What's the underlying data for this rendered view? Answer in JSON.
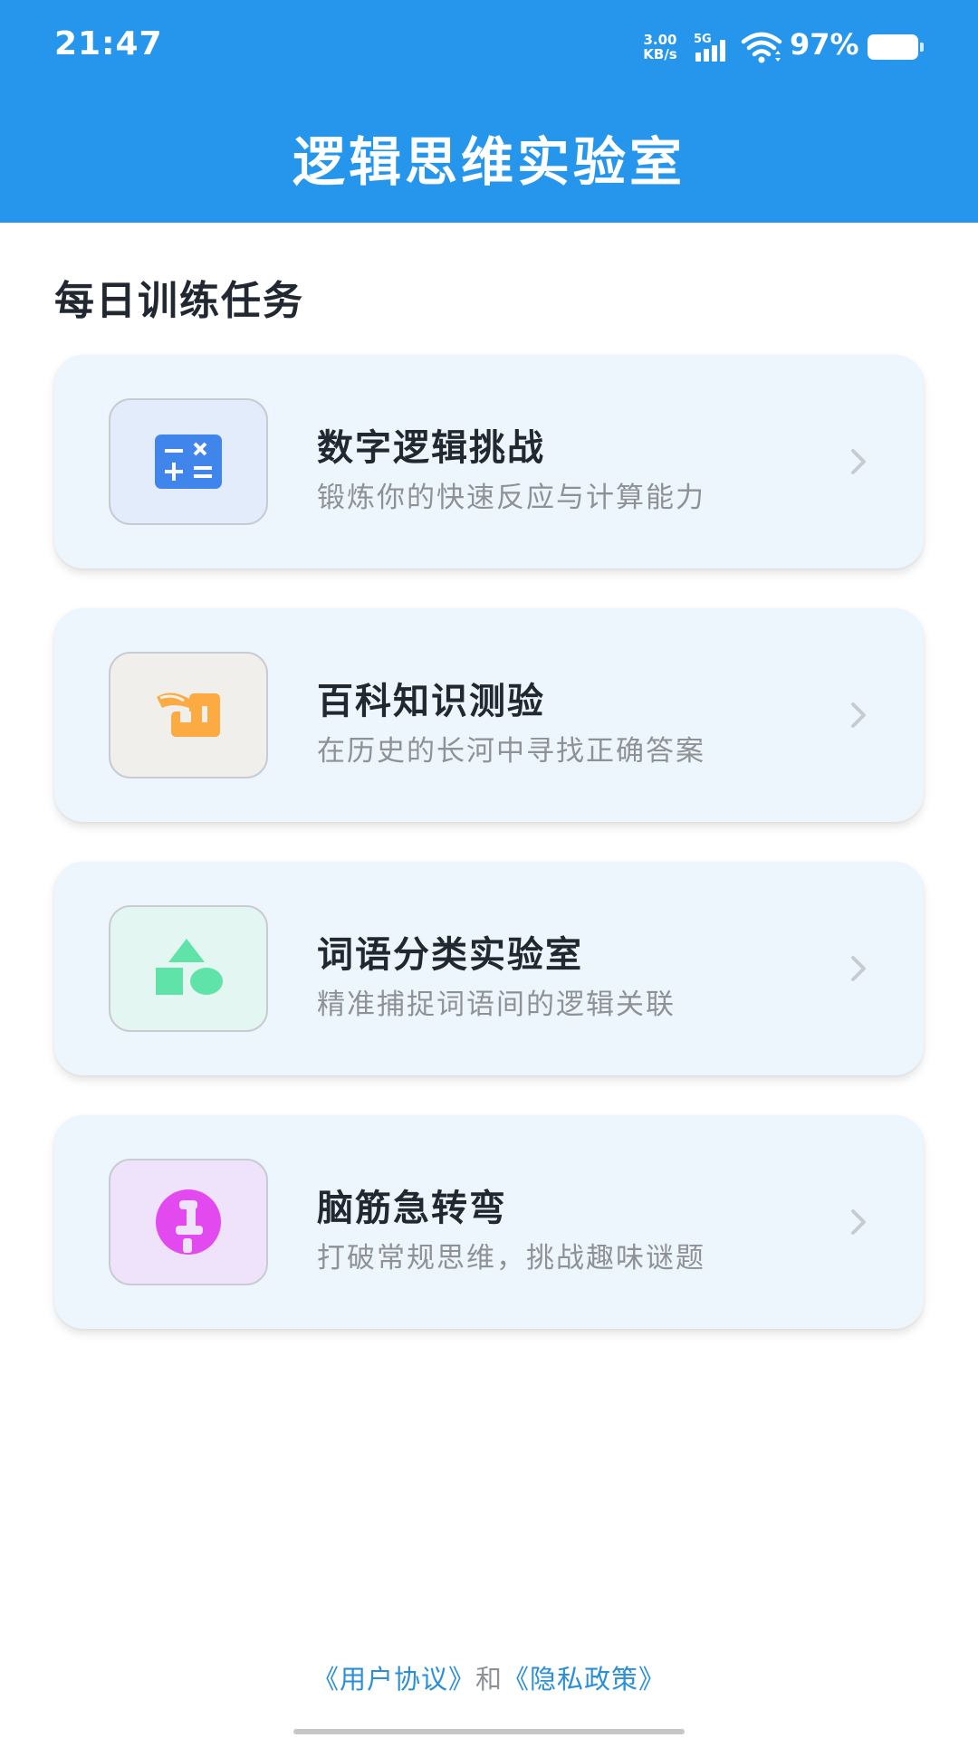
{
  "status_bar": {
    "time": "21:47",
    "net_speed_value": "3.00",
    "net_speed_unit": "KB/s",
    "network_type": "5G",
    "battery_percent": "97%"
  },
  "header": {
    "title": "逻辑思维实验室"
  },
  "section": {
    "title": "每日训练任务"
  },
  "cards": [
    {
      "title": "数字逻辑挑战",
      "subtitle": "锻炼你的快速反应与计算能力",
      "icon": "calculator-icon",
      "icon_bg": "#e2ecfb",
      "icon_color": "#3f85ec"
    },
    {
      "title": "百科知识测验",
      "subtitle": "在历史的长河中寻找正确答案",
      "icon": "scroll-icon",
      "icon_bg": "#f1efec",
      "icon_color": "#fbab42"
    },
    {
      "title": "词语分类实验室",
      "subtitle": "精准捕捉词语间的逻辑关联",
      "icon": "shapes-icon",
      "icon_bg": "#e3f6f2",
      "icon_color": "#5fe3a9"
    },
    {
      "title": "脑筋急转弯",
      "subtitle": "打破常规思维，挑战趣味谜题",
      "icon": "puzzle-icon",
      "icon_bg": "#efe3fb",
      "icon_color": "#e24af0"
    }
  ],
  "footer": {
    "user_agreement": "《用户协议》",
    "and_text": "和",
    "privacy_policy": "《隐私政策》"
  },
  "colors": {
    "primary": "#2596ec",
    "card_bg": "#edf5fd",
    "title_text": "#222831",
    "sub_text": "#8e9297",
    "link": "#2b8fd8"
  }
}
